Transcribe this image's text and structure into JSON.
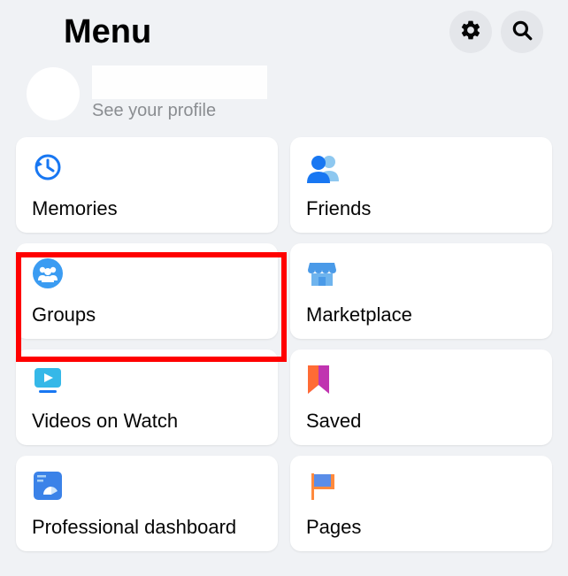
{
  "header": {
    "title": "Menu"
  },
  "profile": {
    "subtext": "See your profile"
  },
  "tiles": [
    {
      "label": "Memories"
    },
    {
      "label": "Friends"
    },
    {
      "label": "Groups"
    },
    {
      "label": "Marketplace"
    },
    {
      "label": "Videos on Watch"
    },
    {
      "label": "Saved"
    },
    {
      "label": "Professional dashboard"
    },
    {
      "label": "Pages"
    }
  ]
}
